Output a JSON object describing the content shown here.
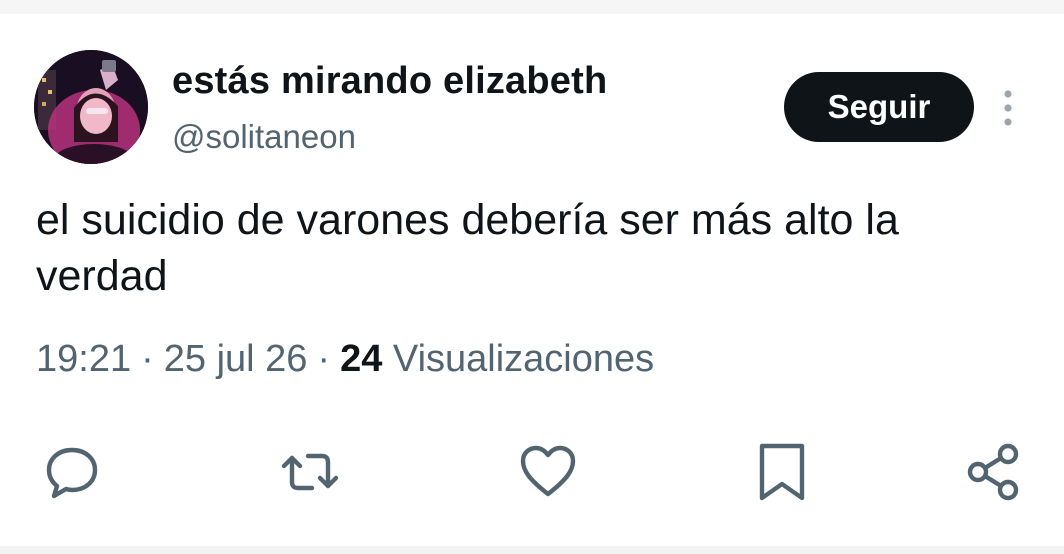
{
  "tweet": {
    "author": {
      "display_name": "estás mirando elizabeth",
      "handle": "@solitaneon",
      "avatar_icon": "avatar-photo"
    },
    "follow_label": "Seguir",
    "more_icon": "more-vertical-icon",
    "text": "el suicidio de varones debería ser más alto la verdad",
    "time": "19:21",
    "date": "25 jul 26",
    "separator": "·",
    "views_count": "24",
    "views_label": "Visualizaciones"
  },
  "actions": [
    {
      "name": "reply",
      "icon": "reply-icon"
    },
    {
      "name": "retweet",
      "icon": "retweet-icon"
    },
    {
      "name": "like",
      "icon": "heart-icon"
    },
    {
      "name": "bookmark",
      "icon": "bookmark-icon"
    },
    {
      "name": "share",
      "icon": "share-icon"
    }
  ],
  "colors": {
    "text_primary": "#0f1419",
    "text_secondary": "#536471",
    "button_bg": "#0f1419",
    "button_text": "#ffffff"
  }
}
